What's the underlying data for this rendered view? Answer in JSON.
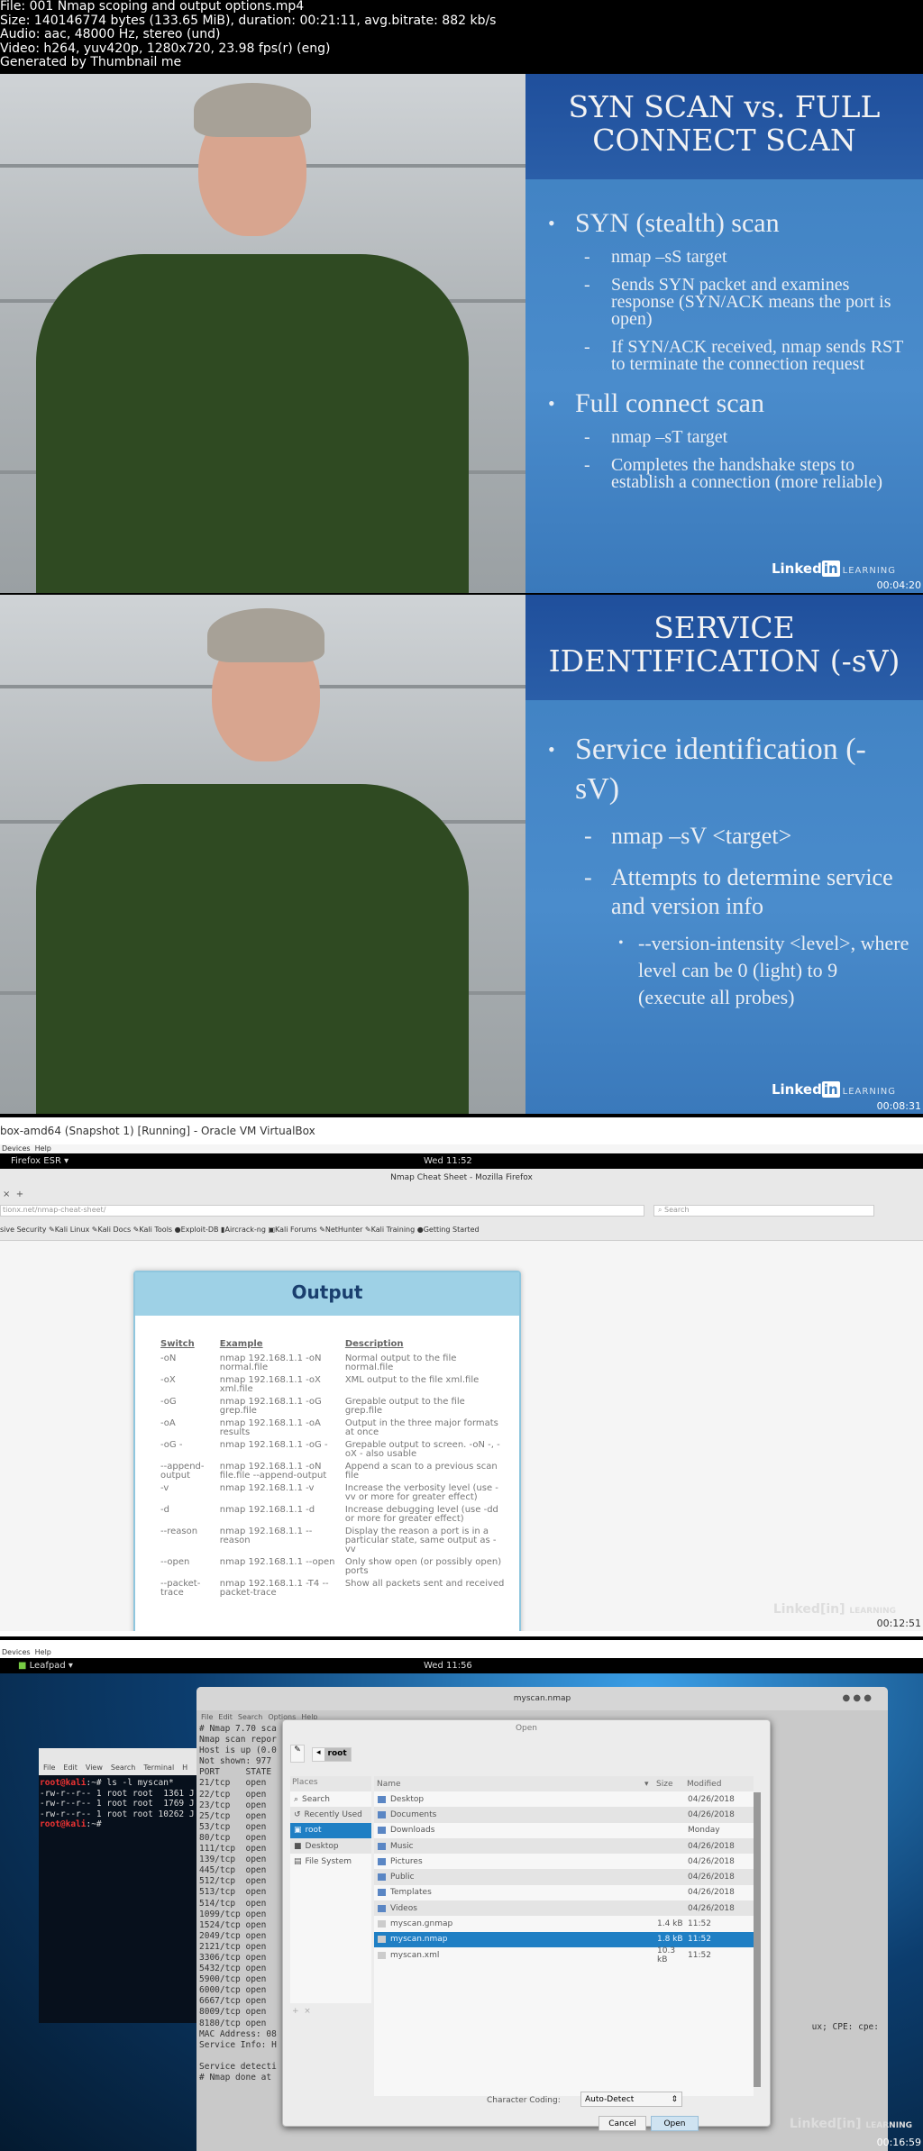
{
  "header": {
    "lines": [
      "File: 001 Nmap scoping and output options.mp4",
      "Size: 140146774 bytes (133.65 MiB), duration: 00:21:11, avg.bitrate: 882 kb/s",
      "Audio: aac, 48000 Hz, stereo (und)",
      "Video: h264, yuv420p, 1280x720, 23.98 fps(r) (eng)",
      "Generated by Thumbnail me"
    ]
  },
  "frame1": {
    "title": "SYN SCAN vs. FULL CONNECT SCAN",
    "b1": "SYN (stealth) scan",
    "b1a": "nmap –sS target",
    "b1b": "Sends SYN packet and examines response (SYN/ACK means the port is open)",
    "b1c": "If SYN/ACK received, nmap sends RST to terminate the connection request",
    "b2": "Full connect scan",
    "b2a": "nmap –sT target",
    "b2b": "Completes the handshake steps to establish a connection (more reliable)",
    "timestamp": "00:04:20"
  },
  "frame2": {
    "title": "SERVICE IDENTIFICATION (-sV)",
    "b1": "Service identification (-sV)",
    "b1a": "nmap –sV <target>",
    "b1b": "Attempts to determine service and version info",
    "b1c": "--version-intensity <level>, where level can be 0 (light) to 9 (execute all probes)",
    "timestamp": "00:08:31"
  },
  "logo": {
    "brand": "Linked",
    "in": "in",
    "learning": "LEARNING"
  },
  "frame3": {
    "vbox_title": "box-amd64 (Snapshot 1) [Running] - Oracle VM VirtualBox",
    "menu": [
      "Devices",
      "Help"
    ],
    "app": "Firefox ESR ▾",
    "clock": "Wed 11:52",
    "window_title": "Nmap Cheat Sheet - Mozilla Firefox",
    "url": "tionx.net/nmap-cheat-sheet/",
    "search_placeholder": "Search",
    "bookmarks": [
      "sive Security",
      "Kali Linux",
      "Kali Docs",
      "Kali Tools",
      "Exploit-DB",
      "Aircrack-ng",
      "Kali Forums",
      "NetHunter",
      "Kali Training",
      "Getting Started"
    ],
    "card_title": "Output",
    "headers": [
      "Switch",
      "Example",
      "Description"
    ],
    "rows": [
      [
        "-oN",
        "nmap 192.168.1.1 -oN normal.file",
        "Normal output to the file normal.file"
      ],
      [
        "-oX",
        "nmap 192.168.1.1 -oX xml.file",
        "XML output to the file xml.file"
      ],
      [
        "-oG",
        "nmap 192.168.1.1 -oG grep.file",
        "Grepable output to the file grep.file"
      ],
      [
        "-oA",
        "nmap 192.168.1.1 -oA results",
        "Output in the three major formats at once"
      ],
      [
        "-oG -",
        "nmap 192.168.1.1 -oG -",
        "Grepable output to screen. -oN -, -oX - also usable"
      ],
      [
        "--append-output",
        "nmap 192.168.1.1 -oN file.file --append-output",
        "Append a scan to a previous scan file"
      ],
      [
        "-v",
        "nmap 192.168.1.1 -v",
        "Increase the verbosity level (use -vv or more for greater effect)"
      ],
      [
        "-d",
        "nmap 192.168.1.1 -d",
        "Increase debugging level (use -dd or more for greater effect)"
      ],
      [
        "--reason",
        "nmap 192.168.1.1 --reason",
        "Display the reason a port is in a particular state, same output as -vv"
      ],
      [
        "--open",
        "nmap 192.168.1.1 --open",
        "Only show open (or possibly open) ports"
      ],
      [
        "--packet-trace",
        "nmap 192.168.1.1 -T4 --packet-trace",
        "Show all packets sent and received"
      ]
    ],
    "timestamp": "00:12:51"
  },
  "frame4": {
    "vbox_title": "box-amd64 (Snapshot 1) [Running] - Oracle VM VirtualBox",
    "menu": [
      "Devices",
      "Help"
    ],
    "app": "Leafpad ▾",
    "clock": "Wed 11:56",
    "leafpad_title": "myscan.nmap",
    "leafpad_menu": [
      "File",
      "Edit",
      "Search",
      "Options",
      "Help"
    ],
    "leafpad_lines": [
      "# Nmap 7.70 sca",
      "Nmap scan repor",
      "Host is up (0.0",
      "Not shown: 977",
      "PORT     STATE",
      "21/tcp   open",
      "22/tcp   open",
      "23/tcp   open",
      "25/tcp   open",
      "53/tcp   open",
      "80/tcp   open",
      "111/tcp  open",
      "139/tcp  open",
      "445/tcp  open",
      "512/tcp  open",
      "513/tcp  open",
      "514/tcp  open",
      "1099/tcp open",
      "1524/tcp open",
      "2049/tcp open",
      "2121/tcp open",
      "3306/tcp open",
      "5432/tcp open",
      "5900/tcp open",
      "6000/tcp open",
      "6667/tcp open",
      "8009/tcp open",
      "8180/tcp open",
      "MAC Address: 08",
      "Service Info: H",
      "",
      "Service detecti",
      "# Nmap done at"
    ],
    "leafpad_right": "ux; CPE: cpe:",
    "terminal_menu": [
      "File",
      "Edit",
      "View",
      "Search",
      "Terminal",
      "H"
    ],
    "terminal_lines": [
      {
        "prompt": "root@kali",
        "cmd": ":~# ls -l myscan*"
      },
      {
        "prompt": "",
        "cmd": "-rw-r--r-- 1 root root  1361 J"
      },
      {
        "prompt": "",
        "cmd": "-rw-r--r-- 1 root root  1769 J"
      },
      {
        "prompt": "",
        "cmd": "-rw-r--r-- 1 root root 10262 J"
      },
      {
        "prompt": "root@kali",
        "cmd": ":~# "
      }
    ],
    "dialog": {
      "title": "Open",
      "path": "root",
      "places_header": "Places",
      "places": [
        "Search",
        "Recently Used",
        "root",
        "Desktop",
        "File System"
      ],
      "columns": [
        "Name",
        "Size",
        "Modified"
      ],
      "files": [
        [
          "Desktop",
          "",
          "04/26/2018"
        ],
        [
          "Documents",
          "",
          "04/26/2018"
        ],
        [
          "Downloads",
          "",
          "Monday"
        ],
        [
          "Music",
          "",
          "04/26/2018"
        ],
        [
          "Pictures",
          "",
          "04/26/2018"
        ],
        [
          "Public",
          "",
          "04/26/2018"
        ],
        [
          "Templates",
          "",
          "04/26/2018"
        ],
        [
          "Videos",
          "",
          "04/26/2018"
        ],
        [
          "myscan.gnmap",
          "1.4 kB",
          "11:52"
        ],
        [
          "myscan.nmap",
          "1.8 kB",
          "11:52"
        ],
        [
          "myscan.xml",
          "10.3 kB",
          "11:52"
        ]
      ],
      "selected": "myscan.nmap",
      "coding_label": "Character Coding:",
      "coding_value": "Auto-Detect",
      "cancel": "Cancel",
      "open": "Open"
    },
    "timestamp": "00:16:59"
  }
}
